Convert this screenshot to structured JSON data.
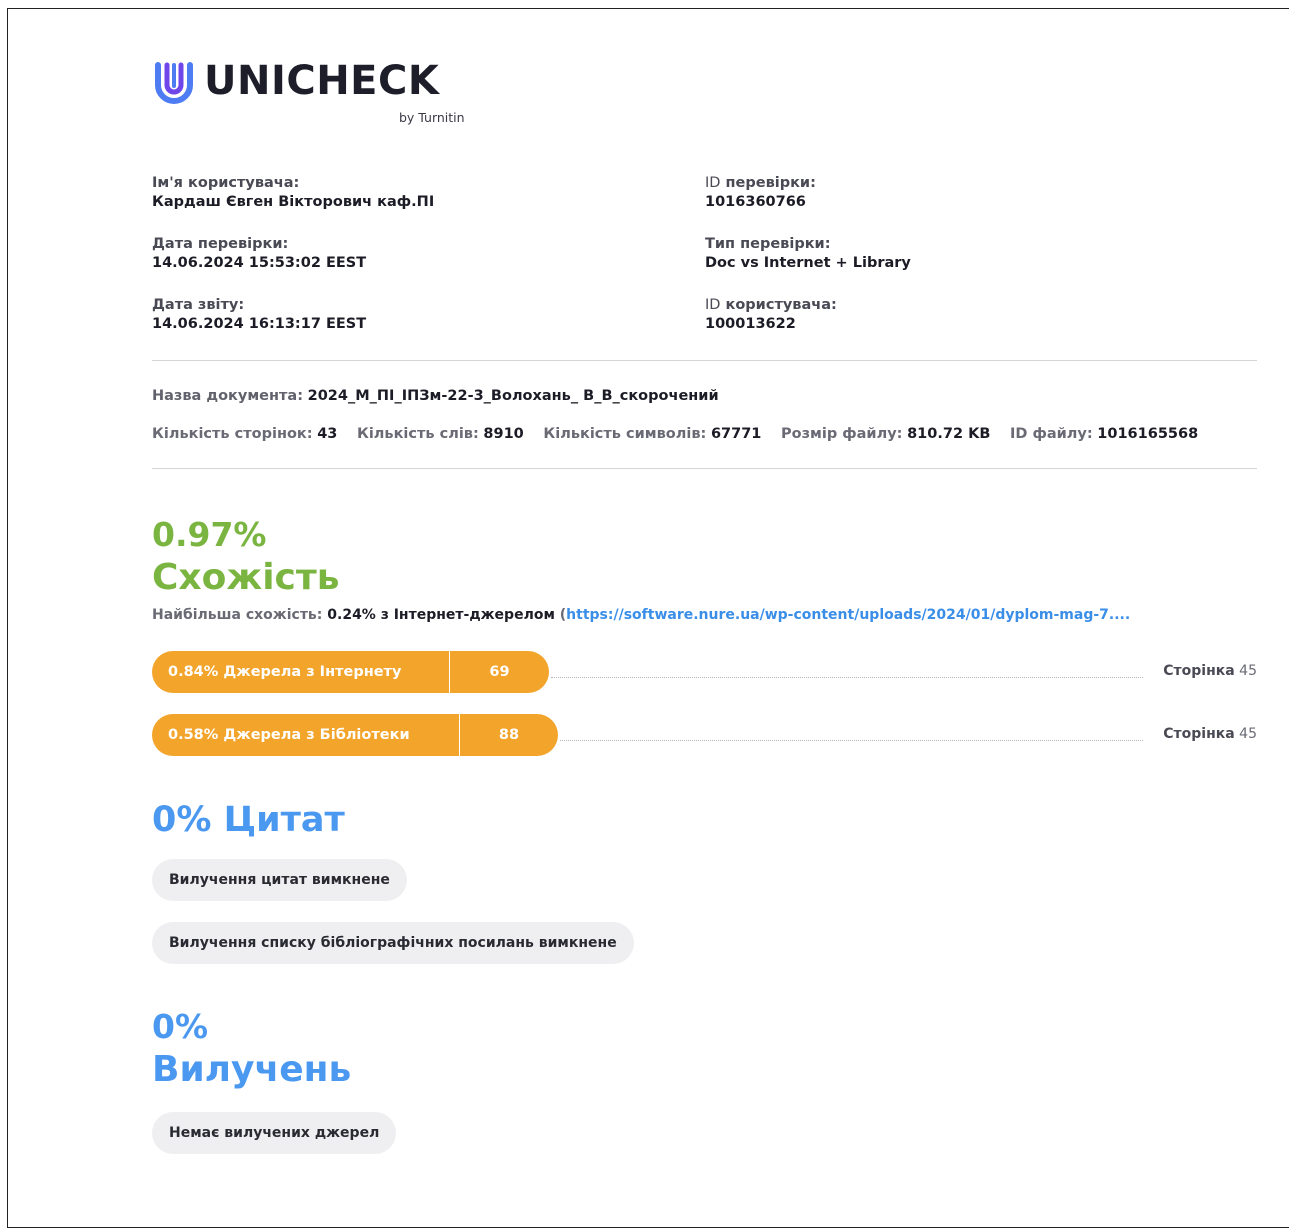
{
  "brand": {
    "name": "UNICHECK",
    "sub": "by Turnitin",
    "icon": "unicheck-u-logo",
    "colors": {
      "mark_blue": "#4d7cf3",
      "mark_purple": "#6f46ea"
    }
  },
  "meta": {
    "left": [
      {
        "label": "Ім'я користувача:",
        "value": "Кардаш Євген Вікторович каф.ПІ"
      },
      {
        "label": "Дата перевірки:",
        "value": "14.06.2024 15:53:02 EEST"
      },
      {
        "label": "Дата звіту:",
        "value": "14.06.2024 16:13:17 EEST"
      }
    ],
    "right": [
      {
        "label_prefix": "ID",
        "label": " перевірки:",
        "value": "1016360766"
      },
      {
        "label_prefix": "",
        "label": "Тип перевірки:",
        "value": "Doc vs Internet + Library"
      },
      {
        "label_prefix": "ID",
        "label": " користувача:",
        "value": "100013622"
      }
    ]
  },
  "document": {
    "name_label": "Назва документа:",
    "name_value": "2024_М_ПІ_ІПЗм-22-3_Волохань_ В_В_скорочений",
    "stats": [
      {
        "label": "Кількість сторінок:",
        "value": "43"
      },
      {
        "label": "Кількість слів:",
        "value": "8910"
      },
      {
        "label": "Кількість символів:",
        "value": "67771"
      },
      {
        "label": "Розмір файлу:",
        "value": "810.72 KB"
      },
      {
        "label": "ID файлу:",
        "value": "1016165568"
      }
    ]
  },
  "similarity": {
    "percent": "0.97%",
    "title": "Схожість",
    "top_label": "Найбільша схожість:",
    "top_value": "0.24% з Інтернет-джерелом",
    "top_paren_open": " (",
    "top_link": "https://software.nure.ua/wp-content/uploads/2024/01/dyplom-mag-7....",
    "color": "#7bb541",
    "sources": [
      {
        "label": "0.84% Джерела з Інтернету",
        "count": "69",
        "page_label": "Сторінка",
        "page": "45"
      },
      {
        "label": "0.58% Джерела з Бібліотеки",
        "count": "88",
        "page_label": "Сторінка",
        "page": "45"
      }
    ],
    "pill_color": "#f2a42b"
  },
  "citations": {
    "title": "0% Цитат",
    "chips": [
      "Вилучення цитат вимкнене",
      "Вилучення списку бібліографічних посилань вимкнене"
    ],
    "color": "#4a98f0"
  },
  "exclusions": {
    "percent": "0%",
    "title": "Вилучень",
    "chip": "Немає вилучених джерел"
  }
}
